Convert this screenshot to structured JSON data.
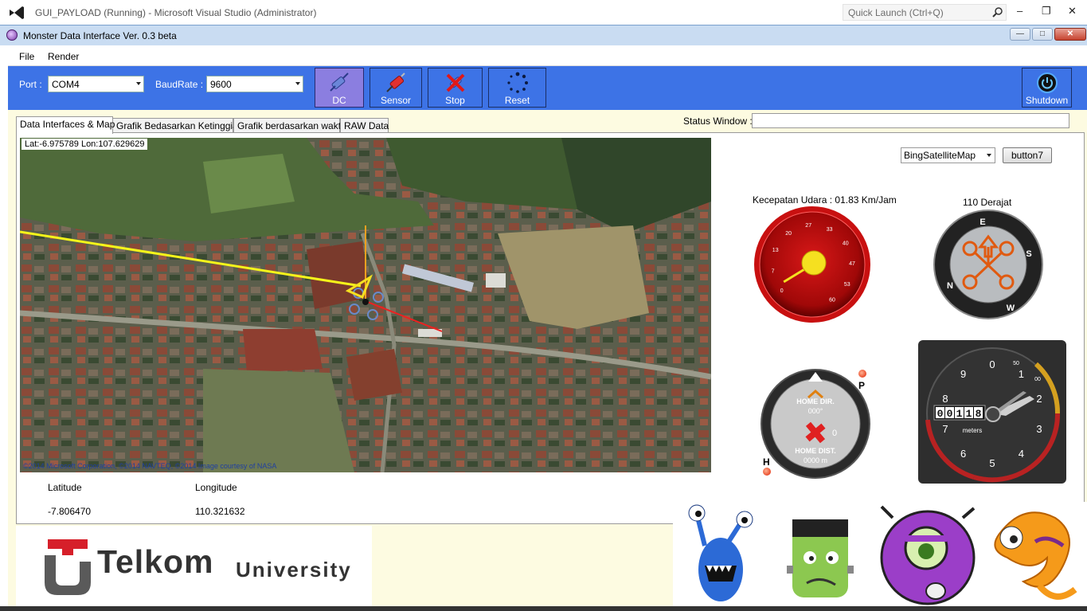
{
  "vs": {
    "title": "GUI_PAYLOAD (Running) - Microsoft Visual Studio (Administrator)",
    "quick_launch": "Quick Launch (Ctrl+Q)"
  },
  "app": {
    "title": "Monster Data Interface Ver. 0.3 beta"
  },
  "menu": {
    "file": "File",
    "render": "Render"
  },
  "toolbar": {
    "port_label": "Port :",
    "port_value": "COM4",
    "baud_label": "BaudRate :",
    "baud_value": "9600",
    "dc": "DC",
    "sensor": "Sensor",
    "stop": "Stop",
    "reset": "Reset",
    "shutdown": "Shutdown"
  },
  "tabs": [
    {
      "label": "Data Interfaces & Map"
    },
    {
      "label": "Grafik Bedasarkan Ketinggian"
    },
    {
      "label": "Grafik berdasarkan waktu"
    },
    {
      "label": "RAW Data"
    }
  ],
  "status": {
    "label": "Status Window :"
  },
  "map": {
    "latlon": "Lat:-6.975789 Lon:107.629629",
    "copyright": "©2014 Microsoft Corporation, ©2014 NAVTEQ, ©2014 Image courtesy of NASA",
    "provider": "BingSatelliteMap",
    "button7": "button7"
  },
  "coords": {
    "lat_label": "Latitude",
    "lon_label": "Longitude",
    "lat_value": "-7.806470",
    "lon_value": "110.321632"
  },
  "gauges": {
    "airspeed_label": "Kecepatan Udara :  01.83 Km/Jam",
    "airspeed_value": 1.83,
    "airspeed_ticks": [
      "0",
      "7",
      "13",
      "20",
      "27",
      "33",
      "40",
      "47",
      "53",
      "60"
    ],
    "heading_label": "110 Derajat",
    "heading_value": 110,
    "home_dir": "HOME DIR.",
    "home_dir_value": "000°",
    "home_dist": "HOME DIST.",
    "home_dist_value": "0000 m",
    "home_zero": "0",
    "p_label": "P",
    "h_label": "H",
    "alt_digits": "00118",
    "alt_unit": "meters",
    "alt_ticks": [
      "0",
      "1",
      "2",
      "3",
      "4",
      "5",
      "6",
      "7",
      "8",
      "9"
    ],
    "alt_sub50": "50",
    "alt_sub100": "00"
  },
  "logo": {
    "brand": "Telkom",
    "sub": "University"
  }
}
